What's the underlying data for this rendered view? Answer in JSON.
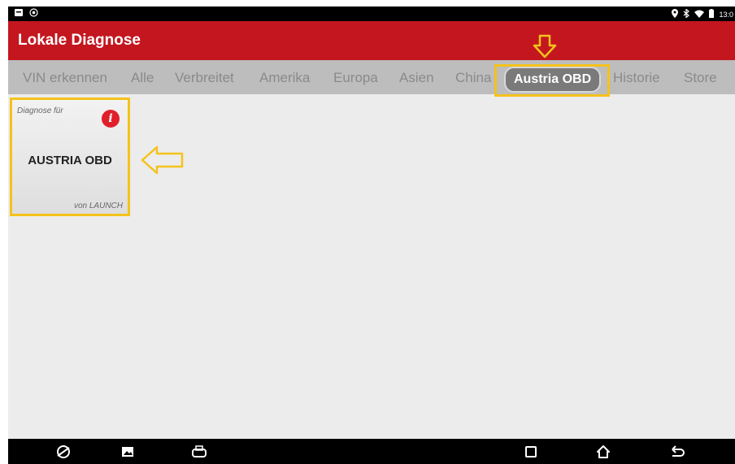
{
  "status_bar": {
    "left_icons": [
      "notification-icon",
      "camera-icon"
    ],
    "right_icons": [
      "location-icon",
      "bluetooth-icon",
      "wifi-icon",
      "battery-icon"
    ],
    "time": "13:0"
  },
  "app_bar": {
    "title": "Lokale Diagnose"
  },
  "tabs": [
    {
      "label": "VIN erkennen"
    },
    {
      "label": "Alle"
    },
    {
      "label": "Verbreitet"
    },
    {
      "label": "Amerika"
    },
    {
      "label": "Europa"
    },
    {
      "label": "Asien"
    },
    {
      "label": "China"
    },
    {
      "label": "Austria OBD",
      "active": true
    },
    {
      "label": "Historie"
    },
    {
      "label": "Store"
    }
  ],
  "cards": [
    {
      "prefix": "Diagnose für",
      "name": "AUSTRIA OBD",
      "maker": "von LAUNCH",
      "badge": "i"
    }
  ],
  "annotations": {
    "highlight_color": "#f4c21b"
  },
  "colors": {
    "accent": "#c4161f",
    "tab_bar": "#bdbdbd",
    "active_tab": "#7a7a7a"
  },
  "nav_bar": {
    "icons": [
      "browser-icon",
      "gallery-icon",
      "vci-icon",
      "recent-apps-icon",
      "home-icon",
      "back-icon"
    ]
  }
}
